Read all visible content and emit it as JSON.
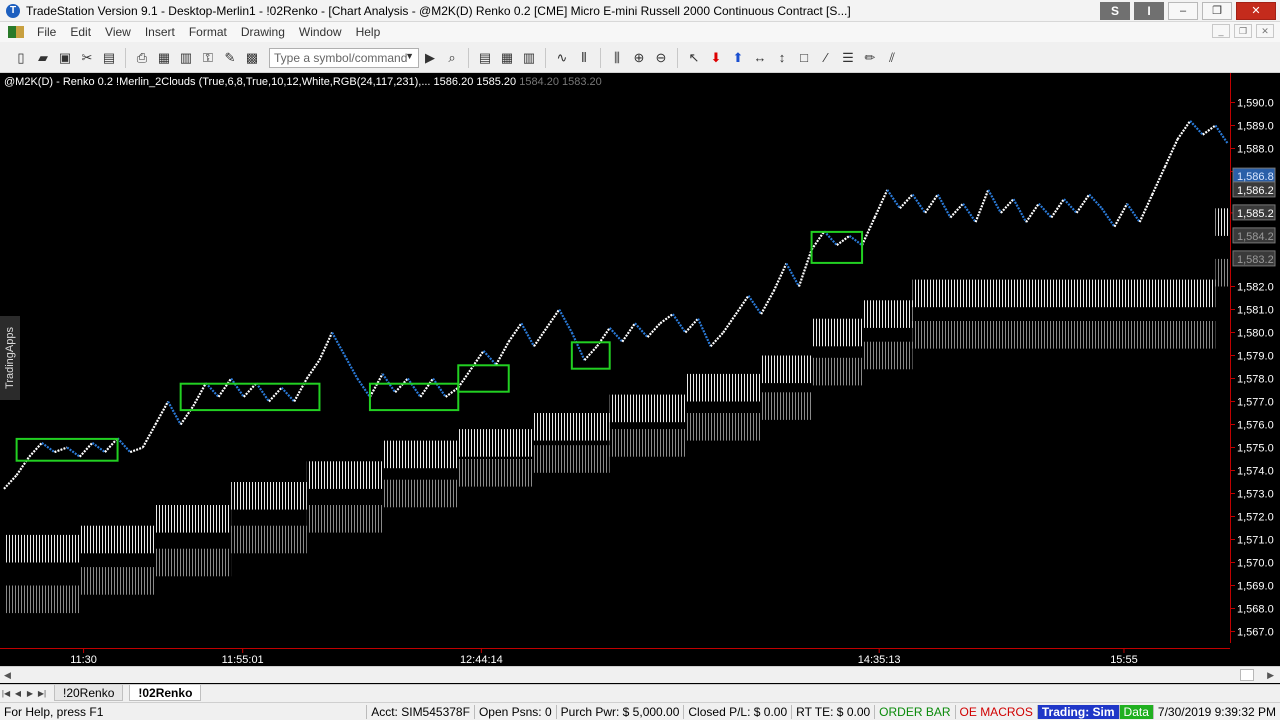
{
  "window": {
    "title": "TradeStation Version 9.1 - Desktop-Merlin1 - !02Renko - [Chart Analysis - @M2K(D) Renko 0.2 [CME] Micro E-mini Russell 2000 Continuous Contract [S...]",
    "app_icon": "T",
    "minimize": "–",
    "restore": "❐",
    "close": "✕",
    "s_button": "S",
    "i_button": "I"
  },
  "menu": {
    "items": [
      "File",
      "Edit",
      "View",
      "Insert",
      "Format",
      "Drawing",
      "Window",
      "Help"
    ]
  },
  "toolbar": {
    "symbol_placeholder": "Type a symbol/command",
    "icons": [
      "new-icon",
      "open-icon",
      "save-icon",
      "cut-icon",
      "print-icon",
      "print-preview-icon",
      "symbol-link-icon",
      "window-link-icon",
      "lock-icon",
      "format-icon",
      "dropdown-icon",
      "go-icon",
      "chart-icon",
      "grid-icon",
      "table-icon",
      "wave-icon",
      "bars-icon",
      "zoom-in-icon",
      "zoom-out-icon",
      "pointer-icon",
      "sell-arrow-icon",
      "buy-arrow-icon",
      "horizontal-resize-icon",
      "vertical-resize-icon",
      "rectangle-icon",
      "trendline-icon",
      "lines-icon",
      "pencil-icon",
      "parallel-lines-icon"
    ]
  },
  "chart": {
    "header_main": "@M2K(D) - Renko 0.2  !Merlin_2Clouds (True,6,8,True,10,12,White,RGB(24,117,231),...  1586.20  1585.20",
    "header_dim": "1584.20  1583.20",
    "side_tab": "TradingApps",
    "price_labels": [
      "1,590.0",
      "1,589.0",
      "1,588.0",
      "1,587.0",
      "1,585.2",
      "1,582.0",
      "1,581.0",
      "1,580.0",
      "1,579.0",
      "1,578.0",
      "1,577.0",
      "1,576.0",
      "1,575.0",
      "1,574.0",
      "1,573.0",
      "1,572.0",
      "1,571.0",
      "1,570.0",
      "1,569.0",
      "1,568.0",
      "1,567.0"
    ],
    "price_tags": [
      "1,586.8",
      "1,586.2",
      "1,585.2",
      "1,584.2",
      "1,583.2"
    ],
    "time_labels": [
      "11:30",
      "11:55:01",
      "12:44:14",
      "14:35:13",
      "15:55"
    ],
    "colors": {
      "up": "#ffffff",
      "down": "#2a7ad8",
      "box": "#22d022",
      "axis": "#c00000"
    }
  },
  "chart_data": {
    "type": "line",
    "title": "",
    "xlabel": "",
    "ylabel": "",
    "ylim": [
      1566.5,
      1590.5
    ],
    "x_ticks": [
      "11:30",
      "11:55:01",
      "12:44:14",
      "14:35:13",
      "15:55"
    ],
    "series": [
      {
        "values": [
          1573.2,
          1573.8,
          1574.6,
          1575.2,
          1574.8,
          1575.0,
          1574.6,
          1575.2,
          1574.8,
          1575.4,
          1574.8,
          1575.0,
          1576.0,
          1577.0,
          1576.0,
          1576.8,
          1577.8,
          1577.2,
          1578.0,
          1577.2,
          1577.8,
          1577.0,
          1577.6,
          1577.0,
          1578.0,
          1578.8,
          1580.0,
          1579.0,
          1578.0,
          1577.2,
          1578.2,
          1577.4,
          1578.0,
          1577.2,
          1578.0,
          1577.2,
          1577.6,
          1578.4,
          1579.2,
          1578.6,
          1579.6,
          1580.4,
          1579.4,
          1580.2,
          1581.0,
          1580.0,
          1578.8,
          1579.4,
          1580.2,
          1579.6,
          1580.4,
          1579.8,
          1580.4,
          1580.8,
          1580.0,
          1580.6,
          1579.4,
          1580.0,
          1580.8,
          1581.6,
          1580.8,
          1581.8,
          1583.0,
          1582.0,
          1583.6,
          1584.4,
          1583.8,
          1584.2,
          1583.8,
          1585.0,
          1586.2,
          1585.4,
          1586.0,
          1585.2,
          1586.0,
          1585.0,
          1585.6,
          1584.8,
          1586.2,
          1585.2,
          1585.8,
          1584.8,
          1585.6,
          1585.0,
          1585.8,
          1585.2,
          1586.0,
          1585.4,
          1584.6,
          1585.6,
          1584.8,
          1586.0,
          1587.2,
          1588.4,
          1589.2,
          1588.6,
          1589.0,
          1588.2
        ]
      }
    ],
    "boxes": [
      {
        "x_from": 1,
        "x_to": 9,
        "low": 1574.6,
        "high": 1575.2
      },
      {
        "x_from": 14,
        "x_to": 25,
        "low": 1576.8,
        "high": 1577.6
      },
      {
        "x_from": 29,
        "x_to": 36,
        "low": 1576.8,
        "high": 1577.6
      },
      {
        "x_from": 36,
        "x_to": 40,
        "low": 1577.6,
        "high": 1578.4
      },
      {
        "x_from": 45,
        "x_to": 48,
        "low": 1578.6,
        "high": 1579.4
      },
      {
        "x_from": 64,
        "x_to": 68,
        "low": 1583.2,
        "high": 1584.2
      }
    ],
    "cloud_fast": [
      1571.2,
      1571.6,
      1572.5,
      1573.5,
      1574.4,
      1575.3,
      1575.8,
      1576.5,
      1577.3,
      1578.2,
      1579.0,
      1580.6,
      1581.4,
      1582.3,
      1582.3,
      1582.3,
      1582.3,
      1585.4
    ],
    "cloud_slow": [
      1569.0,
      1569.8,
      1570.6,
      1571.6,
      1572.5,
      1573.6,
      1574.5,
      1575.1,
      1575.8,
      1576.5,
      1577.4,
      1578.9,
      1579.6,
      1580.5,
      1580.5,
      1580.5,
      1580.5,
      1583.2
    ],
    "cloud_x": [
      0,
      6,
      12,
      18,
      24,
      30,
      36,
      42,
      48,
      54,
      60,
      64,
      68,
      72,
      78,
      84,
      90,
      96
    ]
  },
  "tabs": {
    "nav": [
      "|◀",
      "◀",
      "▶",
      "▶|"
    ],
    "sheets": [
      "!20Renko",
      "!02Renko"
    ]
  },
  "status": {
    "help": "For Help, press F1",
    "acct": "Acct: SIM545378F",
    "open_psns": "Open Psns: 0",
    "purch_pwr": "Purch Pwr: $ 5,000.00",
    "closed_pl": "Closed P/L: $ 0.00",
    "rt_te": "RT TE: $ 0.00",
    "order_bar": "ORDER BAR",
    "oe_macros": "OE MACROS",
    "trading": "Trading: Sim",
    "data": "Data",
    "datetime": "7/30/2019 9:39:32 PM"
  }
}
